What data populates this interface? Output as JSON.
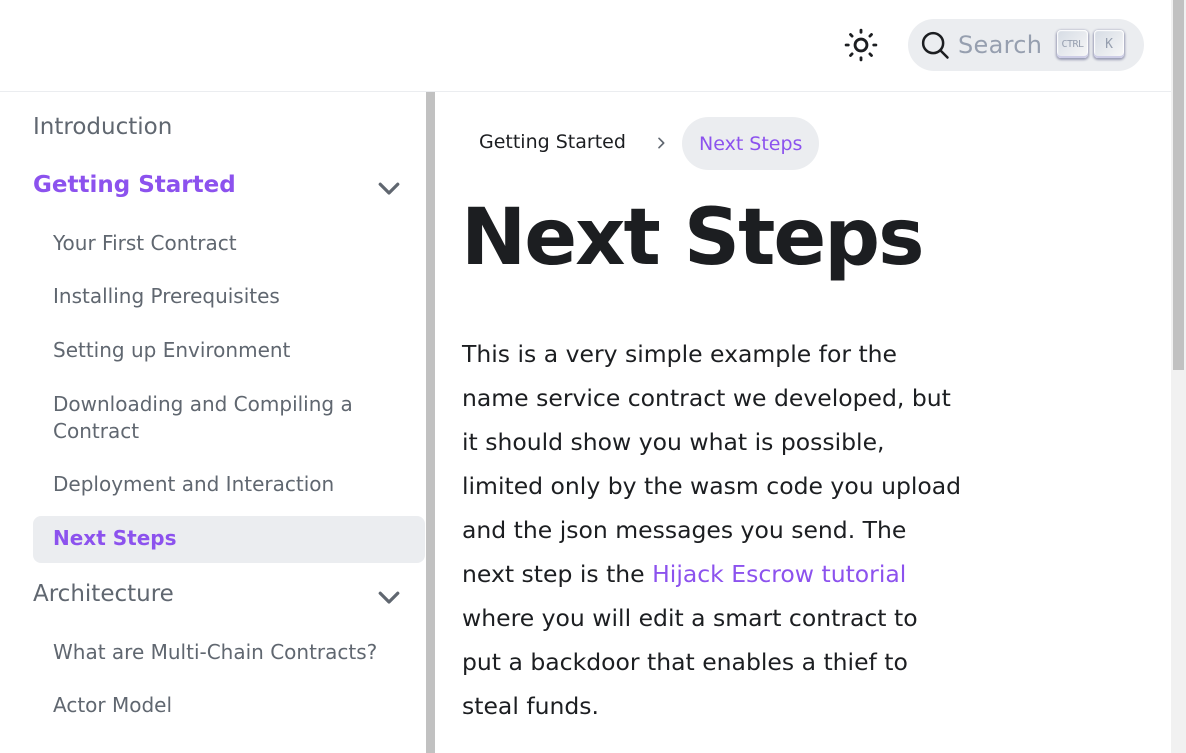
{
  "header": {
    "search_label": "Search",
    "shortcut_ctrl": "CTRL",
    "shortcut_key": "K"
  },
  "sidebar": {
    "introduction": "Introduction",
    "getting_started": "Getting Started",
    "getting_started_items": [
      "Your First Contract",
      "Installing Prerequisites",
      "Setting up Environment",
      "Downloading and Compiling a Contract",
      "Deployment and Interaction",
      "Next Steps"
    ],
    "architecture": "Architecture",
    "architecture_items": [
      "What are Multi-Chain Contracts?",
      "Actor Model"
    ]
  },
  "breadcrumb": {
    "parent": "Getting Started",
    "current": "Next Steps"
  },
  "page": {
    "title": "Next Steps",
    "para_part1": "This is a very simple example for the name service contract we developed, but it should show you what is possible, limited only by the wasm code you upload and the json messages you send. The next step is the ",
    "link_text": "Hijack Escrow tutorial",
    "para_part2": " where you will edit a smart contract to put a backdoor that enables a thief to steal funds."
  },
  "colors": {
    "accent": "#8c52ee",
    "text": "#1c1e21",
    "muted": "#606770",
    "highlight_bg": "#ebedf0"
  }
}
